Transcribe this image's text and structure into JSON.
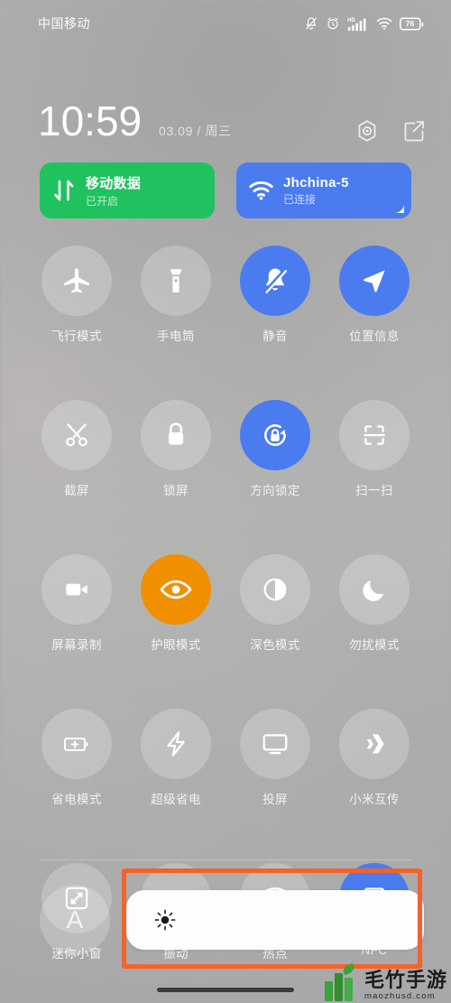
{
  "statusbar": {
    "carrier": "中国移动",
    "icons": [
      "mute-icon",
      "alarm-icon",
      "hd-signal-icon",
      "wifi-icon",
      "battery-icon"
    ],
    "battery_level": "76"
  },
  "clock": {
    "time": "10:59",
    "date": "03.09 / 周三",
    "actions": [
      {
        "name": "settings-gear-icon",
        "label": "设置"
      },
      {
        "name": "edit-icon",
        "label": "编辑"
      }
    ]
  },
  "connection_cards": [
    {
      "id": "mobile-data",
      "title": "移动数据",
      "subtitle": "已开启",
      "icon": "data-transfer-icon",
      "color": "#1fc25f",
      "active": true
    },
    {
      "id": "wifi",
      "title": "Jhchina-5",
      "subtitle": "已连接",
      "icon": "wifi-icon",
      "color": "#4a7cf0",
      "active": true
    }
  ],
  "toggles": [
    {
      "id": "airplane-mode",
      "label": "飞行模式",
      "icon": "airplane-icon",
      "state": "off"
    },
    {
      "id": "flashlight",
      "label": "手电筒",
      "icon": "flashlight-icon",
      "state": "off"
    },
    {
      "id": "silent",
      "label": "静音",
      "icon": "bell-muted-icon",
      "state": "on"
    },
    {
      "id": "location",
      "label": "位置信息",
      "icon": "location-arrow-icon",
      "state": "on"
    },
    {
      "id": "screenshot",
      "label": "截屏",
      "icon": "scissors-icon",
      "state": "off"
    },
    {
      "id": "lock-screen",
      "label": "锁屏",
      "icon": "padlock-icon",
      "state": "off"
    },
    {
      "id": "rotation-lock",
      "label": "方向锁定",
      "icon": "rotation-lock-icon",
      "state": "on"
    },
    {
      "id": "scan",
      "label": "扫一扫",
      "icon": "scan-frame-icon",
      "state": "off"
    },
    {
      "id": "screen-record",
      "label": "屏幕录制",
      "icon": "video-camera-icon",
      "state": "off"
    },
    {
      "id": "reading-mode",
      "label": "护眼模式",
      "icon": "eye-icon",
      "state": "on-orange"
    },
    {
      "id": "dark-mode",
      "label": "深色模式",
      "icon": "contrast-circle-icon",
      "state": "off"
    },
    {
      "id": "do-not-disturb",
      "label": "勿扰模式",
      "icon": "moon-icon",
      "state": "off"
    },
    {
      "id": "battery-saver",
      "label": "省电模式",
      "icon": "battery-plus-icon",
      "state": "off"
    },
    {
      "id": "ultra-battery-saver",
      "label": "超级省电",
      "icon": "lightning-bolt-icon",
      "state": "off"
    },
    {
      "id": "cast",
      "label": "投屏",
      "icon": "monitor-icon",
      "state": "off"
    },
    {
      "id": "mi-share",
      "label": "小米互传",
      "icon": "mi-share-icon",
      "state": "off"
    },
    {
      "id": "mini-window",
      "label": "迷你小窗",
      "icon": "shrink-window-icon",
      "state": "off"
    },
    {
      "id": "vibrate",
      "label": "振动",
      "icon": "vibrate-icon",
      "state": "off"
    },
    {
      "id": "hotspot",
      "label": "热点",
      "icon": "hotspot-icon",
      "state": "off"
    },
    {
      "id": "nfc",
      "label": "NFC",
      "icon": "nfc-icon",
      "state": "on"
    }
  ],
  "brightness": {
    "auto_label": "A",
    "auto_name": "auto-brightness-button",
    "icon": "brightness-sun-icon",
    "value_percent": "100"
  },
  "annotation": {
    "name": "brightness-slider-highlight",
    "color": "#f4622c"
  },
  "watermark": {
    "main": "毛竹手游",
    "sub": "maozhusd.com"
  },
  "colors": {
    "accent_blue": "#4a7cf0",
    "accent_orange": "#f09000",
    "accent_green": "#1fc25f",
    "annotation": "#f4622c",
    "tile_off": "rgba(255,255,255,0.22)"
  }
}
